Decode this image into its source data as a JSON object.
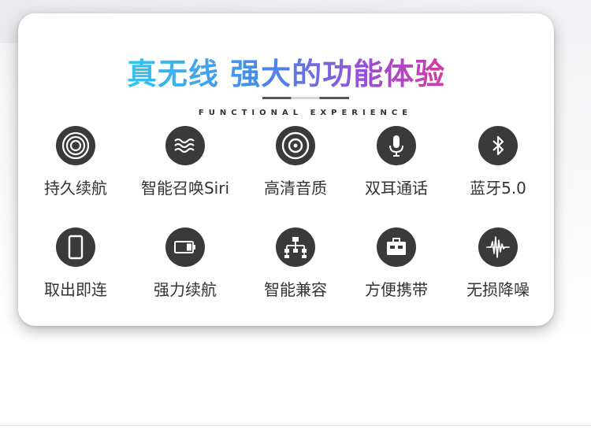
{
  "title": "真无线 强大的功能体验",
  "subtitle": "FUNCTIONAL EXPERIENCE",
  "features": [
    {
      "label": "持久续航",
      "icon": "concentric-circles-icon"
    },
    {
      "label": "智能召唤Siri",
      "icon": "sound-waves-icon"
    },
    {
      "label": "高清音质",
      "icon": "speaker-disc-icon"
    },
    {
      "label": "双耳通话",
      "icon": "microphone-icon"
    },
    {
      "label": "蓝牙5.0",
      "icon": "bluetooth-icon"
    },
    {
      "label": "取出即连",
      "icon": "phone-icon"
    },
    {
      "label": "强力续航",
      "icon": "battery-icon"
    },
    {
      "label": "智能兼容",
      "icon": "network-icon"
    },
    {
      "label": "方便携带",
      "icon": "case-icon"
    },
    {
      "label": "无损降噪",
      "icon": "noise-wave-icon"
    }
  ]
}
